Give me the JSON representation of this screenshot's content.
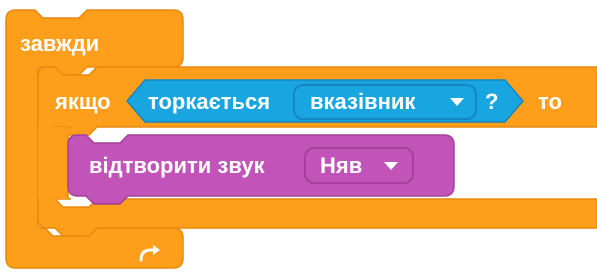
{
  "colors": {
    "control": "#FF9E1B",
    "control_border": "#E58A0E",
    "sensing": "#19A6E0",
    "sensing_border": "#1586BF",
    "sound": "#C253B8",
    "sound_border": "#A5409B",
    "text": "#FFFFFF"
  },
  "blocks": {
    "forever": {
      "label": "завжди",
      "icon": "loop-arrow-icon"
    },
    "if": {
      "label_if": "якщо",
      "label_then": "то"
    },
    "touching": {
      "label": "торкається",
      "dropdown_value": "вказівник",
      "question_mark": "?"
    },
    "play_sound": {
      "label": "відтворити звук",
      "dropdown_value": "Няв"
    }
  }
}
